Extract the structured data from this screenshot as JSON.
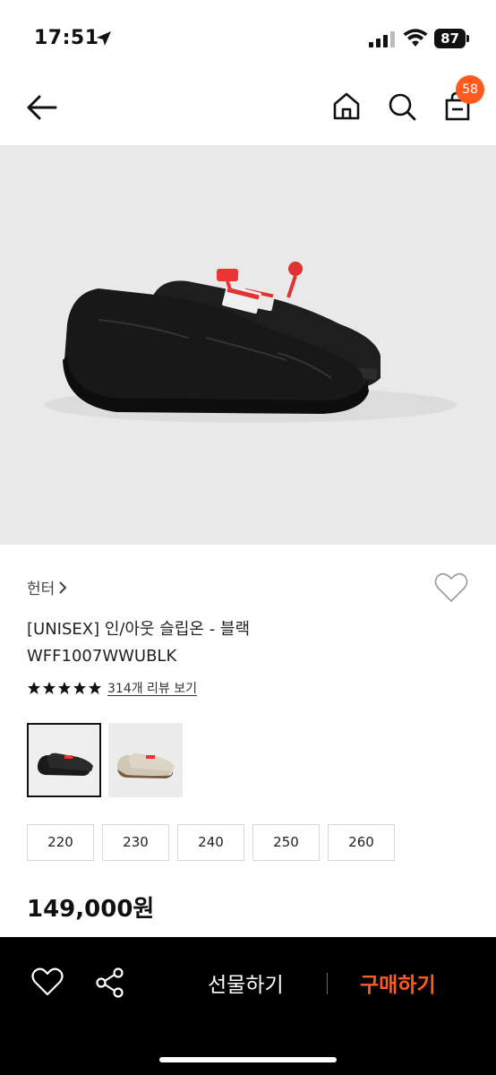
{
  "status": {
    "time": "17:51",
    "battery": "87"
  },
  "nav": {
    "cart_count": "58"
  },
  "product": {
    "brand": "헌터",
    "title": "[UNISEX] 인/아웃 슬립온 - 블랙",
    "code": "WFF1007WWUBLK",
    "rating_stars": 5,
    "review_link": "314개 리뷰 보기",
    "price": "149,000원"
  },
  "variants": [
    {
      "color": "black",
      "selected": true
    },
    {
      "color": "beige",
      "selected": false
    }
  ],
  "sizes": [
    "220",
    "230",
    "240",
    "250",
    "260"
  ],
  "bottom_bar": {
    "gift_label": "선물하기",
    "buy_label": "구매하기"
  },
  "colors": {
    "accent": "#ff5a1f",
    "bottom_bar": "#000000",
    "image_bg": "#e9e9e9"
  }
}
